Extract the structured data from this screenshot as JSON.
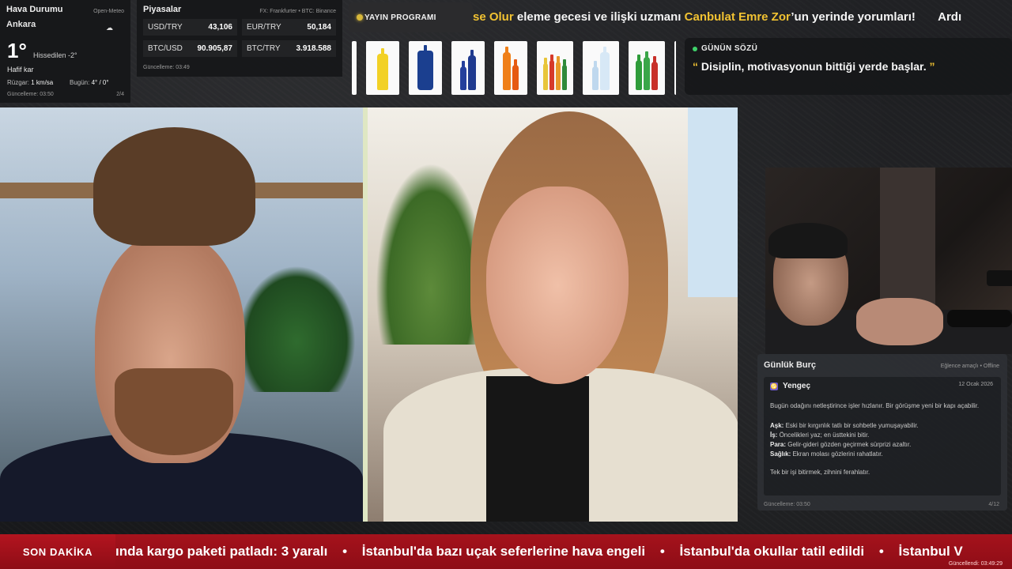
{
  "weather": {
    "title": "Hava Durumu",
    "source": "Open-Meteo",
    "city": "Ankara",
    "temp": "1°",
    "feels": "Hissedilen -2°",
    "condition": "Hafif kar",
    "wind_label": "Rüzgar:",
    "wind_value": "1 km/sa",
    "today_label": "Bugün:",
    "today_value": "4° / 0°",
    "updated": "Güncelleme: 03:50",
    "page": "2/4",
    "icon": "cloud-snow-icon"
  },
  "markets": {
    "title": "Piyasalar",
    "source": "FX: Frankfurter • BTC: Binance",
    "items": [
      {
        "symbol": "USD/TRY",
        "value": "43,106"
      },
      {
        "symbol": "EUR/TRY",
        "value": "50,184"
      },
      {
        "symbol": "BTC/USD",
        "value": "90.905,87"
      },
      {
        "symbol": "BTC/TRY",
        "value": "3.918.588"
      }
    ],
    "updated": "Güncelleme: 03:49"
  },
  "program": {
    "label": "YAYIN PROGRAMI"
  },
  "top_ticker": {
    "pre": "se Olur",
    "mid": " eleme gecesi ve ilişki uzmanı ",
    "name": "Canbulat Emre Zor",
    "post": "’un yerinde yorumları!",
    "next": "Ardı"
  },
  "quote": {
    "title": "GÜNÜN SÖZÜ",
    "open_mark": "“",
    "text": "Disiplin, motivasyonun bittiği yerde başlar.",
    "close_mark": "”"
  },
  "horoscope": {
    "title": "Günlük Burç",
    "note": "Eğlence amaçlı • Offline",
    "sign": "Yengeç",
    "date": "12 Ocak 2026",
    "intro": "Bugün odağını netleştirince işler hızlanır. Bir görüşme yeni bir kapı açabilir.",
    "lines": [
      {
        "label": "Aşk:",
        "text": "Eski bir kırgınlık tatlı bir sohbetle yumuşayabilir."
      },
      {
        "label": "İş:",
        "text": "Öncelikleri yaz; en üsttekini bitir."
      },
      {
        "label": "Para:",
        "text": "Gelir-gideri gözden geçirmek sürprizi azaltır."
      },
      {
        "label": "Sağlık:",
        "text": "Ekran molası gözlerini rahatlatır."
      }
    ],
    "tip": "Tek bir işi bitirmek, zihnini ferahlatır.",
    "updated": "Güncelleme: 03:50",
    "page": "4/12"
  },
  "news": {
    "label": "SON DAKİKA",
    "items": [
      "ında kargo paketi patladı: 3 yaralı",
      "İstanbul'da bazı uçak seferlerine hava engeli",
      "İstanbul'da okullar tatil edildi",
      "İstanbul V"
    ],
    "separator": "•",
    "updated": "Güncellendi: 03:49:29"
  },
  "colors": {
    "accent_yellow": "#f1c232",
    "news_red": "#a5121c",
    "quote_dot": "#3fd16a"
  }
}
